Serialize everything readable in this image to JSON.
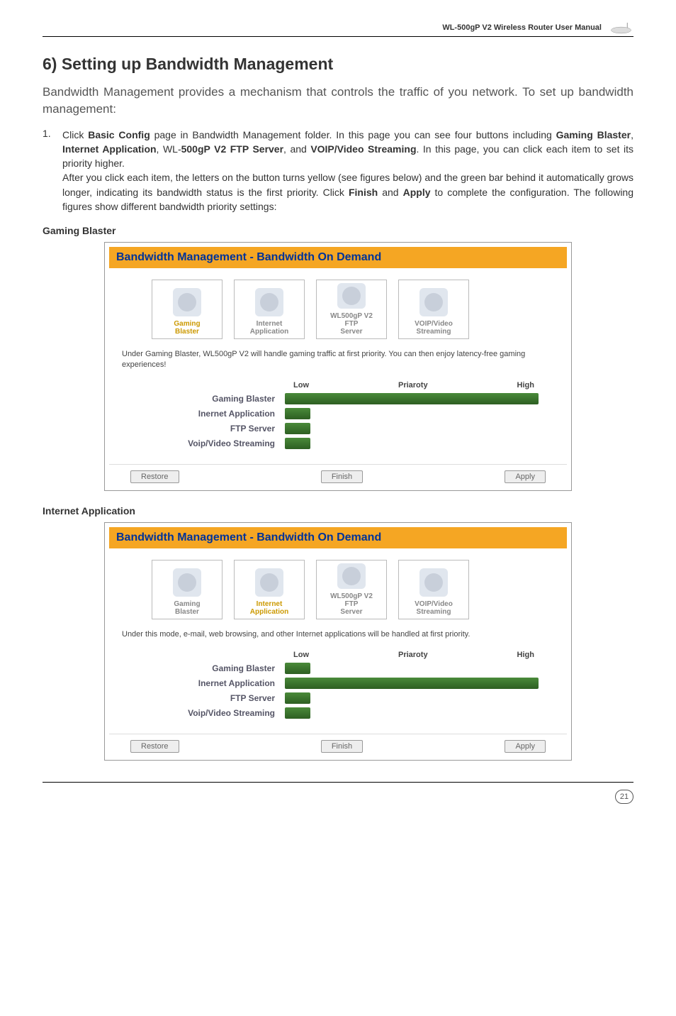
{
  "header": {
    "manual_title": "WL-500gP V2 Wireless Router User Manual"
  },
  "section": {
    "heading": "6) Setting up Bandwidth Management",
    "intro": "Bandwidth Management provides a mechanism that controls the traffic of you network. To set up bandwidth management:",
    "step_num": "1.",
    "step_text_1": "Click ",
    "step_bold_1": "Basic Config",
    "step_text_2": " page in Bandwidth Management folder. In this page you can see four buttons including ",
    "step_bold_2": "Gaming Blaster",
    "step_text_3": ", ",
    "step_bold_3": "Internet Application",
    "step_text_4": ", WL-",
    "step_bold_4": "500gP V2 FTP Server",
    "step_text_5": ", and ",
    "step_bold_5": "VOIP/Video Streaming",
    "step_text_6": ". In this page, you can click each item to set its priority higher.",
    "step_para2_a": "After you click each item, the letters on the button turns yellow (see figures below) and the green bar behind it automatically grows longer, indicating its bandwidth status is the first priority. Click ",
    "step_bold_finish": "Finish",
    "step_para2_b": " and ",
    "step_bold_apply": "Apply",
    "step_para2_c": " to complete the configuration. The following figures show different bandwidth priority settings:"
  },
  "panel": {
    "title": "Bandwidth Management - Bandwidth On Demand",
    "modes": {
      "gaming": "Gaming\nBlaster",
      "internet": "Internet\nApplication",
      "ftp": "WL500gP V2\nFTP\nServer",
      "voip": "VOIP/Video\nStreaming"
    },
    "low": "Low",
    "high": "High",
    "priority": "Priaroty",
    "rows": {
      "gaming": "Gaming Blaster",
      "inernet": "Inernet Application",
      "ftp": "FTP Server",
      "voip": "Voip/Video Streaming"
    },
    "buttons": {
      "restore": "Restore",
      "finish": "Finish",
      "apply": "Apply"
    }
  },
  "chart_data": [
    {
      "type": "bar",
      "title": "Gaming Blaster priority",
      "categories": [
        "Gaming Blaster",
        "Inernet Application",
        "FTP Server",
        "Voip/Video Streaming"
      ],
      "values": [
        100,
        10,
        10,
        10
      ],
      "ylim": [
        0,
        100
      ],
      "desc": "Under Gaming Blaster, WL500gP V2 will handle gaming traffic at first priority. You can then enjoy latency-free gaming experiences!"
    },
    {
      "type": "bar",
      "title": "Internet Application priority",
      "categories": [
        "Gaming Blaster",
        "Inernet Application",
        "FTP Server",
        "Voip/Video Streaming"
      ],
      "values": [
        10,
        100,
        10,
        10
      ],
      "ylim": [
        0,
        100
      ],
      "desc": "Under this mode, e-mail, web browsing, and other Internet applications will be handled at first priority."
    }
  ],
  "subheads": {
    "gaming": "Gaming Blaster",
    "internet": "Internet Application"
  },
  "footer": {
    "page": "21"
  }
}
